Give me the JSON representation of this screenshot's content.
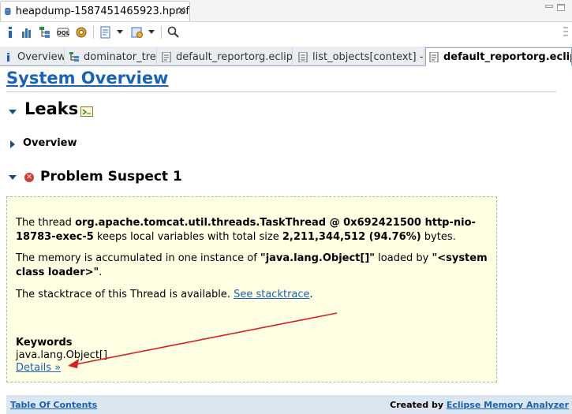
{
  "editor": {
    "file_tab": "heapdump-1587451465923.hprof",
    "close_glyph": "✕"
  },
  "toolbar": {
    "icons": [
      "info-icon",
      "histogram-icon",
      "dominator-tree-icon",
      "oql-icon",
      "heap-dump-details-icon",
      "run-report-icon",
      "query-browser-icon",
      "find-object-icon"
    ]
  },
  "tabs": [
    {
      "label": "Overview",
      "icon": "info-icon"
    },
    {
      "label": "dominator_tree",
      "icon": "dominator-tree-icon"
    },
    {
      "label_a": "default_report",
      "label_b": "org.eclip",
      "icon": "report-icon"
    },
    {
      "label_a": "list_objects",
      "label_b": "[context] -i",
      "icon": "list-objects-icon"
    },
    {
      "label_a": "default_report",
      "label_b": "org.eclip",
      "icon": "report-icon",
      "active": true
    }
  ],
  "report": {
    "title": "System Overview",
    "leaks_heading": "Leaks",
    "overview_heading": "Overview",
    "suspect_heading": "Problem Suspect 1",
    "p1": {
      "t1": "The thread ",
      "b1": "org.apache.tomcat.util.threads.TaskThread @ 0x692421500 http-nio-18783-exec-5",
      "t2": " keeps local variables with total size ",
      "b2": "2,211,344,512 (94.76%)",
      "t3": " bytes."
    },
    "p2": {
      "t1": "The memory is accumulated in one instance of ",
      "b1": "\"java.lang.Object[]\"",
      "t2": " loaded by ",
      "b2": "\"<system class loader>\"",
      "t3": "."
    },
    "p3": {
      "t1": "The stacktrace of this Thread is available. ",
      "link": "See stacktrace",
      "t2": "."
    },
    "keywords_label": "Keywords",
    "keyword_value": "java.lang.Object[]",
    "details_link": "Details »"
  },
  "footer": {
    "toc": "Table Of Contents",
    "created_by": "Created by ",
    "analyzer_link": "Eclipse Memory Analyzer"
  },
  "colors": {
    "link": "#1a62b8",
    "suspect_bg": "#ffffe4",
    "footer_bg": "#dce6f1",
    "annotation_arrow": "#d61f1f"
  }
}
